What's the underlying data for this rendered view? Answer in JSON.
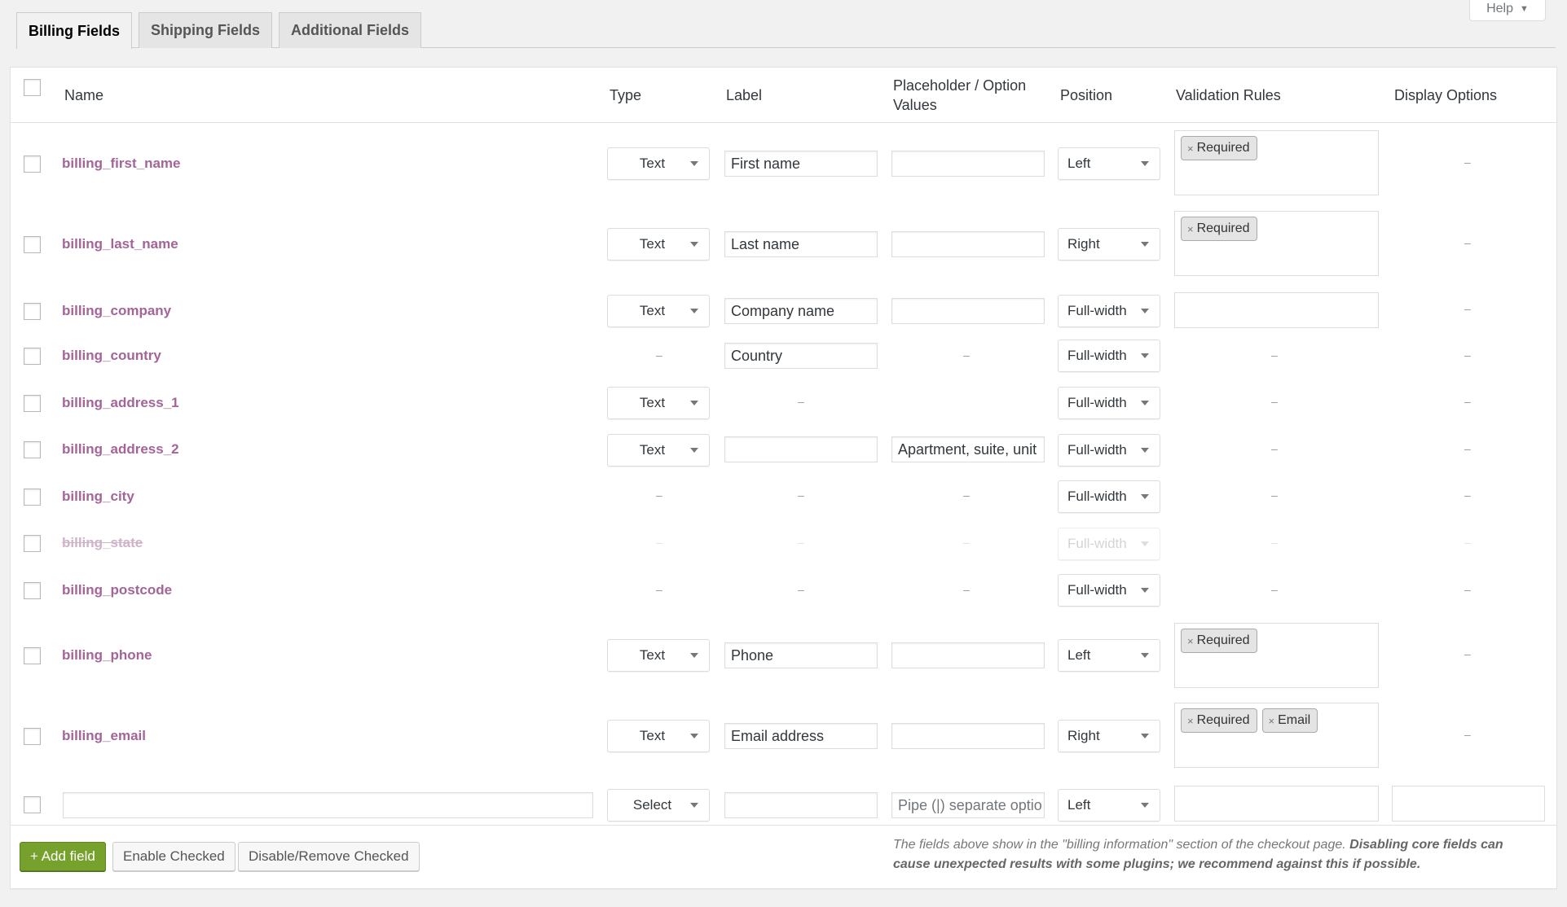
{
  "help": {
    "label": "Help",
    "arrow": "▼"
  },
  "tabs": [
    {
      "label": "Billing Fields",
      "active": true
    },
    {
      "label": "Shipping Fields",
      "active": false
    },
    {
      "label": "Additional Fields",
      "active": false
    }
  ],
  "columns": {
    "name": "Name",
    "type": "Type",
    "label": "Label",
    "placeholder": "Placeholder / Option Values",
    "position": "Position",
    "validation": "Validation Rules",
    "display": "Display Options"
  },
  "dash": "–",
  "rows": [
    {
      "name": "billing_first_name",
      "type": "Text",
      "label": "First name",
      "placeholder": "",
      "position": "Left",
      "validation": [
        "Required"
      ],
      "display": "–"
    },
    {
      "name": "billing_last_name",
      "type": "Text",
      "label": "Last name",
      "placeholder": "",
      "position": "Right",
      "validation": [
        "Required"
      ],
      "display": "–"
    },
    {
      "name": "billing_company",
      "type": "Text",
      "label": "Company name",
      "placeholder": "",
      "position": "Full-width",
      "validation": [],
      "display": "–"
    },
    {
      "name": "billing_country",
      "type": "–",
      "label": "Country",
      "placeholder": "–",
      "position": "Full-width",
      "validation": "–",
      "display": "–"
    },
    {
      "name": "billing_address_1",
      "type": "Text",
      "label": "–",
      "placeholder": "",
      "position": "Full-width",
      "validation": "–",
      "display": "–"
    },
    {
      "name": "billing_address_2",
      "type": "Text",
      "label": "",
      "placeholder": "Apartment, suite, unit",
      "position": "Full-width",
      "validation": "–",
      "display": "–"
    },
    {
      "name": "billing_city",
      "type": "–",
      "label": "–",
      "placeholder": "–",
      "position": "Full-width",
      "validation": "–",
      "display": "–"
    },
    {
      "name": "billing_state",
      "type": "–",
      "label": "–",
      "placeholder": "–",
      "position": "Full-width",
      "validation": "–",
      "display": "–",
      "disabled": true
    },
    {
      "name": "billing_postcode",
      "type": "–",
      "label": "–",
      "placeholder": "–",
      "position": "Full-width",
      "validation": "–",
      "display": "–"
    },
    {
      "name": "billing_phone",
      "type": "Text",
      "label": "Phone",
      "placeholder": "",
      "position": "Left",
      "validation": [
        "Required"
      ],
      "display": "–"
    },
    {
      "name": "billing_email",
      "type": "Text",
      "label": "Email address",
      "placeholder": "",
      "position": "Right",
      "validation": [
        "Required",
        "Email"
      ],
      "display": "–"
    }
  ],
  "new_row": {
    "name": "",
    "type": "Select",
    "label": "",
    "placeholder_hint": "Pipe (|) separate optio",
    "position": "Left"
  },
  "footer": {
    "add_field": "+ Add field",
    "enable_checked": "Enable Checked",
    "disable_checked": "Disable/Remove Checked",
    "note_plain": "The fields above show in the \"billing information\" section of the checkout page. ",
    "note_bold": "Disabling core fields can cause unexpected results with some plugins; we recommend against this if possible."
  },
  "colors": {
    "field_name": "#a46497",
    "add_button": "#75a12c"
  }
}
